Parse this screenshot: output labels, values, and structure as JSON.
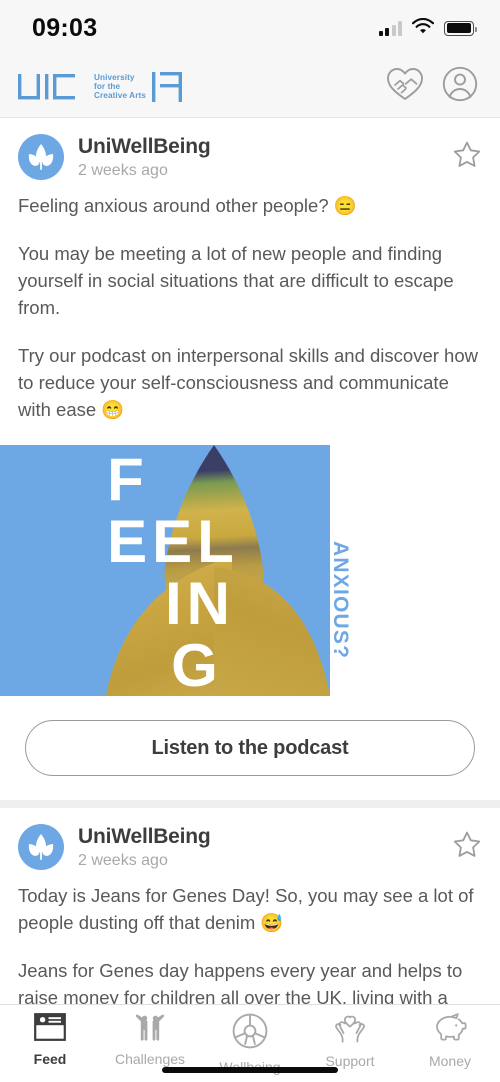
{
  "status_bar": {
    "time": "09:03",
    "signal_icon": "cellular-signal-icon",
    "wifi_icon": "wifi-icon",
    "battery_icon": "battery-full-icon",
    "signal_bars_filled": 2,
    "signal_bars_total": 4
  },
  "app_bar": {
    "logo_name": "uca-logo",
    "logo_line1": "University",
    "logo_line2": "for the",
    "logo_line3": "Creative Arts",
    "logo_color": "#5b9bd5",
    "partners_icon": "handshake-heart-icon",
    "profile_icon": "user-profile-icon"
  },
  "feed": {
    "posts": [
      {
        "author": "UniWellBeing",
        "timestamp": "2 weeks ago",
        "avatar_icon": "plant-leaf-avatar",
        "bookmark_icon": "star-outline-icon",
        "paragraphs": [
          "Feeling anxious around other people? 😑",
          "You may be meeting a lot of new people and finding yourself in social situations that are difficult to escape from.",
          "Try our podcast on interpersonal skills and discover how to reduce your self-consciousness and communicate with ease 😁"
        ],
        "artwork": {
          "name": "podcast-artwork",
          "line1": "F",
          "line2": "EEL",
          "line3": "IN",
          "line4": "G",
          "vertical_text": "ANXIOUS?",
          "background_color": "#6ea8e4",
          "text_color": "#ffffff"
        },
        "cta_label": "Listen to the podcast"
      },
      {
        "author": "UniWellBeing",
        "timestamp": "2 weeks ago",
        "avatar_icon": "plant-leaf-avatar",
        "bookmark_icon": "star-outline-icon",
        "paragraphs": [
          "Today is Jeans for Genes Day! So, you may see a lot of people dusting off that denim 😅",
          "Jeans for Genes day happens every year and helps to raise money for children all over the UK, living with a"
        ]
      }
    ]
  },
  "tab_bar": {
    "items": [
      {
        "label": "Feed",
        "icon": "feed-card-icon",
        "active": true
      },
      {
        "label": "Challenges",
        "icon": "two-people-icon",
        "active": false
      },
      {
        "label": "Wellbeing",
        "icon": "wellbeing-wheel-icon",
        "active": false
      },
      {
        "label": "Support",
        "icon": "hands-heart-icon",
        "active": false
      },
      {
        "label": "Money",
        "icon": "piggy-bank-icon",
        "active": false
      }
    ],
    "active_color": "#3d3d3d",
    "inactive_color": "#a9a9a9"
  },
  "home_indicator": "home-indicator"
}
